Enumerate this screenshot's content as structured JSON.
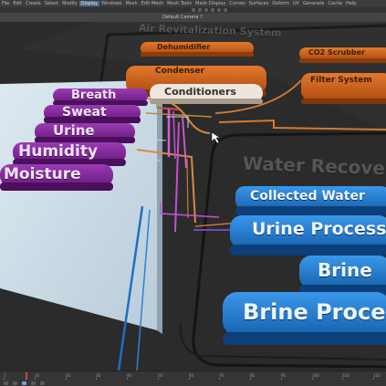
{
  "menubar": {
    "items": [
      "File",
      "Edit",
      "Create",
      "Select",
      "Modify",
      "Display",
      "Windows",
      "Mesh",
      "Edit Mesh",
      "Mesh Tools",
      "Mesh Display",
      "Curves",
      "Surfaces",
      "Deform",
      "UV",
      "Generate",
      "Cache",
      "Help"
    ],
    "selected_index": 5
  },
  "viewport": {
    "camera_label": "Default Camera ?"
  },
  "scene": {
    "group_titles": {
      "revitalization": "Air Revitalization System",
      "water": "Water Recovery"
    },
    "purple_nodes": [
      "Breath",
      "Sweat",
      "Urine",
      "Humidity",
      "Moisture"
    ],
    "orange_nodes": [
      "Dehumidifier",
      "Condenser",
      "Conditioners",
      "CO2 Scrubber",
      "Filter System"
    ],
    "blue_nodes": [
      "Collected Water",
      "Urine Processor",
      "Brine",
      "Brine Processor"
    ]
  },
  "timeline": {
    "ticks": [
      "1",
      "10",
      "20",
      "30",
      "40",
      "50",
      "60",
      "70",
      "80",
      "90",
      "100",
      "110",
      "120"
    ]
  },
  "colors": {
    "purple": "#7e2596",
    "orange": "#c85a14",
    "blue": "#1d78cf",
    "panel": "#c9dbe6",
    "background": "#2a2a2a"
  }
}
